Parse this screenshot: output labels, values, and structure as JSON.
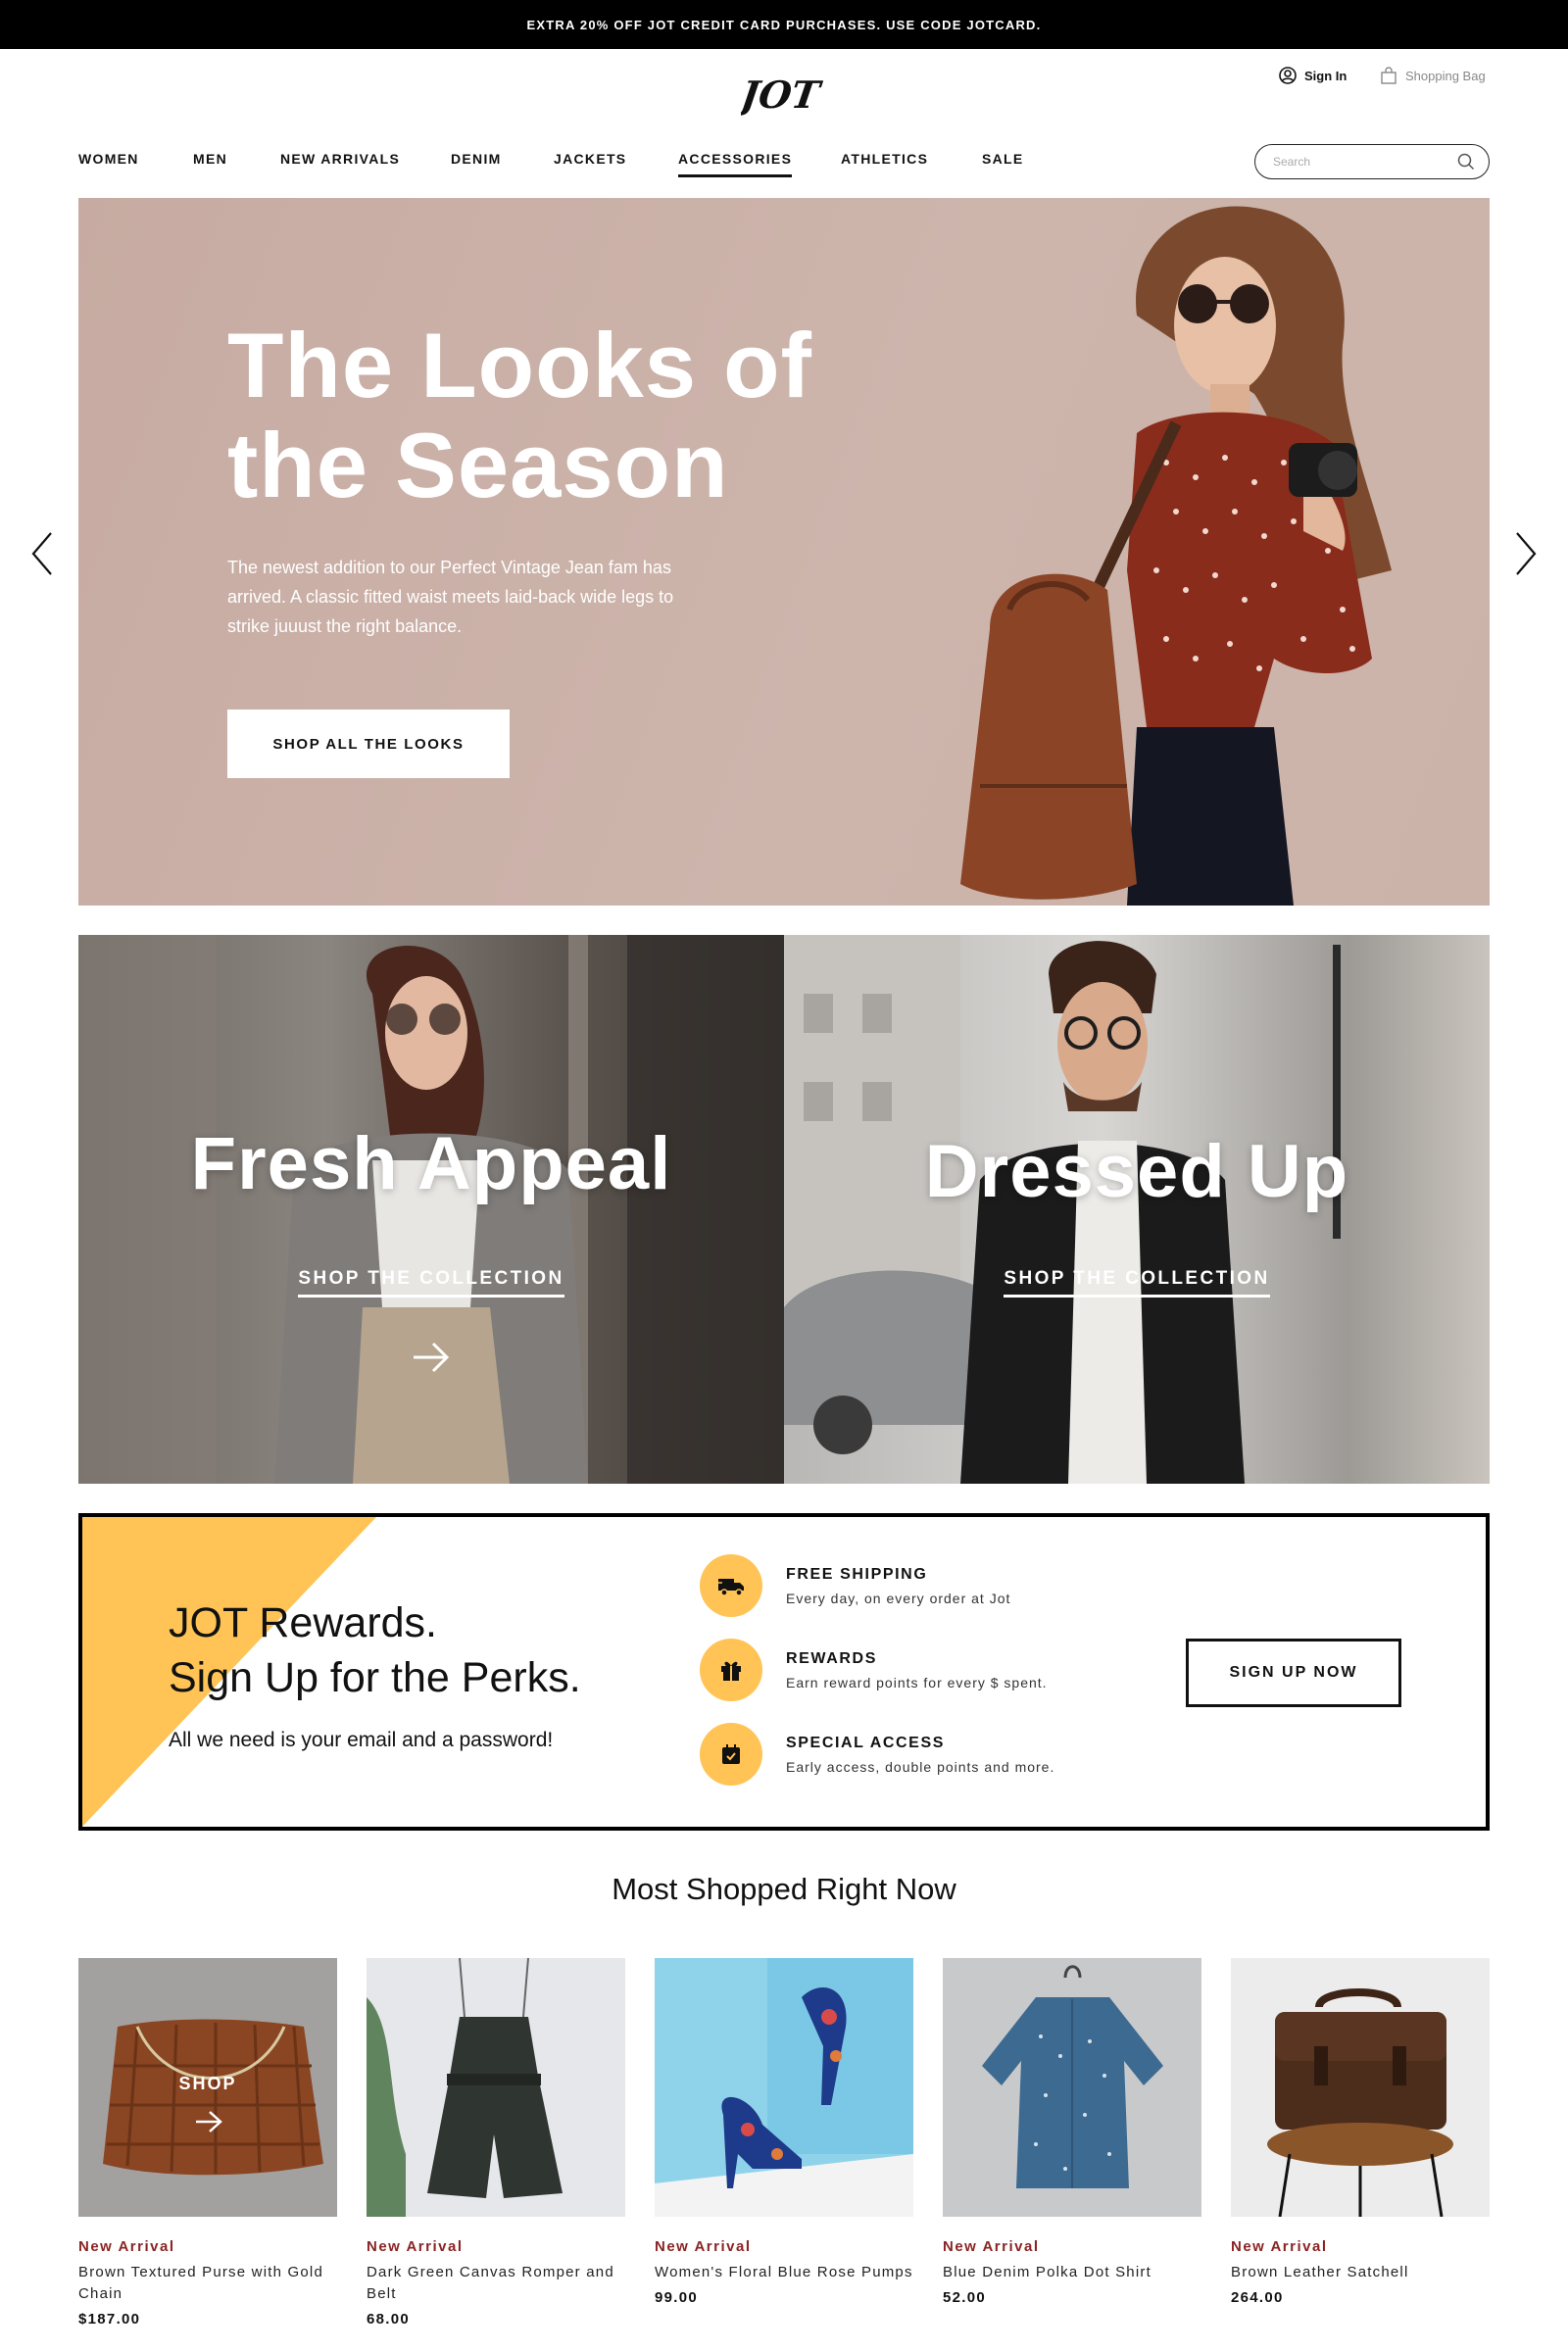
{
  "promo": {
    "text": "EXTRA 20% OFF JOT CREDIT CARD PURCHASES. USE CODE JOTCARD."
  },
  "header": {
    "logo": "JOT",
    "sign_in": "Sign In",
    "bag": "Shopping Bag",
    "search_placeholder": "Search"
  },
  "nav": {
    "items": [
      {
        "label": "WOMEN"
      },
      {
        "label": "MEN"
      },
      {
        "label": "NEW ARRIVALS"
      },
      {
        "label": "DENIM"
      },
      {
        "label": "JACKETS"
      },
      {
        "label": "ACCESSORIES",
        "active": true
      },
      {
        "label": "ATHLETICS"
      },
      {
        "label": "SALE"
      }
    ]
  },
  "hero": {
    "title": "The Looks of the Season",
    "description": "The newest addition to our Perfect Vintage Jean fam has arrived. A classic fitted waist meets laid-back wide legs to strike juuust the right balance.",
    "button": "SHOP ALL THE LOOKS"
  },
  "collections": [
    {
      "title": "Fresh Appeal",
      "link": "SHOP THE COLLECTION"
    },
    {
      "title": "Dressed Up",
      "link": "SHOP THE COLLECTION"
    }
  ],
  "rewards": {
    "title_line1": "JOT Rewards.",
    "title_line2": "Sign Up for the Perks.",
    "subtitle": "All we need is your email and a password!",
    "button": "SIGN UP NOW",
    "accent_color": "#ffc455",
    "perks": [
      {
        "title": "FREE SHIPPING",
        "desc": "Every day, on every order at Jot",
        "icon": "truck-icon"
      },
      {
        "title": "REWARDS",
        "desc": "Earn reward points for every $ spent.",
        "icon": "gift-icon"
      },
      {
        "title": "SPECIAL ACCESS",
        "desc": "Early access, double points and more.",
        "icon": "calendar-icon"
      }
    ]
  },
  "products_section": {
    "title": "Most Shopped Right Now",
    "shop_overlay": "SHOP",
    "items": [
      {
        "tag": "New Arrival",
        "name": "Brown Textured Purse with Gold Chain",
        "price": "$187.00"
      },
      {
        "tag": "New Arrival",
        "name": "Dark Green Canvas Romper and Belt",
        "price": "68.00"
      },
      {
        "tag": "New Arrival",
        "name": "Women's Floral Blue Rose Pumps",
        "price": "99.00"
      },
      {
        "tag": "New Arrival",
        "name": "Blue Denim Polka Dot Shirt",
        "price": "52.00"
      },
      {
        "tag": "New Arrival",
        "name": "Brown Leather Satchell",
        "price": "264.00"
      }
    ]
  }
}
